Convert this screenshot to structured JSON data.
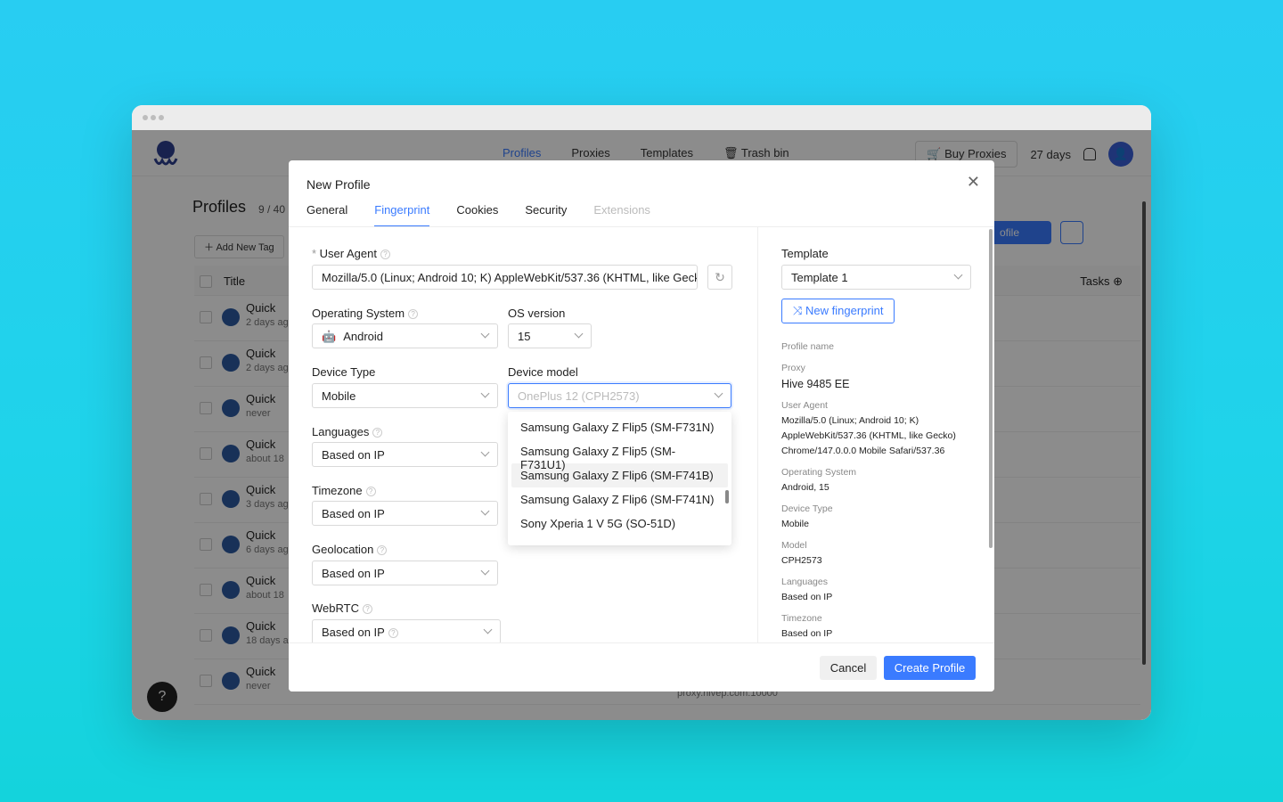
{
  "nav": {
    "links": [
      "Profiles",
      "Proxies",
      "Templates",
      "Trash bin"
    ],
    "buy_proxies": "Buy Proxies",
    "days_left": "27 days"
  },
  "profiles_page": {
    "title": "Profiles",
    "count": "9 / 40",
    "add_tag": "Add New Tag",
    "col_title": "Title",
    "col_tasks": "Tasks",
    "create_partial": "ofile",
    "proxy_footer": "proxy.hivep.com:10000",
    "rows": [
      {
        "name": "Quick",
        "sub": "2 days ag"
      },
      {
        "name": "Quick",
        "sub": "2 days ag"
      },
      {
        "name": "Quick",
        "sub": "never"
      },
      {
        "name": "Quick",
        "sub": "about 18"
      },
      {
        "name": "Quick",
        "sub": "3 days ag"
      },
      {
        "name": "Quick",
        "sub": "6 days ag"
      },
      {
        "name": "Quick",
        "sub": "about 18"
      },
      {
        "name": "Quick",
        "sub": "18 days a"
      },
      {
        "name": "Quick",
        "sub": "never"
      }
    ]
  },
  "modal": {
    "title": "New Profile",
    "tabs": [
      "General",
      "Fingerprint",
      "Cookies",
      "Security",
      "Extensions"
    ],
    "active_tab": "Fingerprint",
    "user_agent_label": "User Agent",
    "user_agent_value": "Mozilla/5.0 (Linux; Android 10; K) AppleWebKit/537.36 (KHTML, like Geck",
    "os_label": "Operating System",
    "os_value": "Android",
    "os_version_label": "OS version",
    "os_version_value": "15",
    "device_type_label": "Device Type",
    "device_type_value": "Mobile",
    "device_model_label": "Device model",
    "device_model_placeholder": "OnePlus 12 (CPH2573)",
    "languages_label": "Languages",
    "languages_value": "Based on IP",
    "timezone_label": "Timezone",
    "timezone_value": "Based on IP",
    "geolocation_label": "Geolocation",
    "geolocation_value": "Based on IP",
    "webrtc_label": "WebRTC",
    "webrtc_value": "Based on IP",
    "device_options": [
      "Samsung Galaxy Z Flip5 (SM-F731N)",
      "Samsung Galaxy Z Flip5 (SM-F731U1)",
      "Samsung Galaxy Z Flip6 (SM-F741B)",
      "Samsung Galaxy Z Flip6 (SM-F741N)",
      "Sony Xperia 1 V 5G (SO-51D)"
    ],
    "highlighted_option": "Samsung Galaxy Z Flip6 (SM-F741B)",
    "cancel": "Cancel",
    "create": "Create Profile"
  },
  "summary": {
    "template_label": "Template",
    "template_value": "Template 1",
    "new_fingerprint": "New fingerprint",
    "profile_name_label": "Profile name",
    "proxy_label": "Proxy",
    "proxy_value": "Hive 9485 EE",
    "ua_label": "User Agent",
    "ua_value": "Mozilla/5.0 (Linux; Android 10; K) AppleWebKit/537.36 (KHTML, like Gecko) Chrome/147.0.0.0 Mobile Safari/537.36",
    "os_label": "Operating System",
    "os_value": "Android, 15",
    "device_type_label": "Device Type",
    "device_type_value": "Mobile",
    "model_label": "Model",
    "model_value": "CPH2573",
    "languages_label": "Languages",
    "languages_value": "Based on IP",
    "timezone_label": "Timezone",
    "timezone_value": "Based on IP"
  },
  "colors": {
    "accent": "#3a7bff",
    "overlay": "rgba(0,0,0,0.45)"
  }
}
